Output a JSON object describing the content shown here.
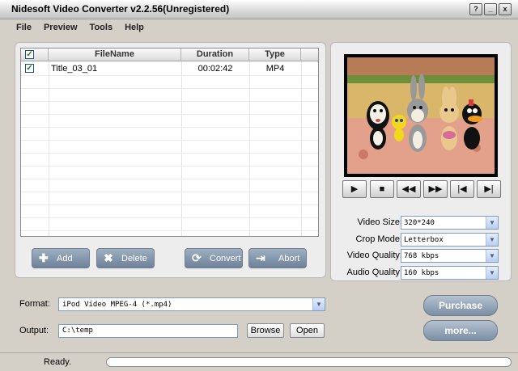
{
  "window": {
    "title": "Nidesoft Video Converter v2.2.56(Unregistered)"
  },
  "window_controls": [
    "?",
    "_",
    "x"
  ],
  "menu": [
    "File",
    "Preview",
    "Tools",
    "Help"
  ],
  "file_list": {
    "columns": [
      "FileName",
      "Duration",
      "Type"
    ],
    "rows": [
      {
        "checked": true,
        "name": "Title_03_01",
        "duration": "00:02:42",
        "type": "MP4"
      }
    ]
  },
  "actions": {
    "add": "Add",
    "delete": "Delete",
    "convert": "Convert",
    "abort": "Abort"
  },
  "player_controls": [
    "play-icon",
    "stop-icon",
    "rewind-icon",
    "fast-forward-icon",
    "skip-start-icon",
    "skip-end-icon"
  ],
  "settings": {
    "video_size": {
      "label": "Video Size:",
      "value": "320*240"
    },
    "crop_mode": {
      "label": "Crop Mode:",
      "value": "Letterbox"
    },
    "video_quality": {
      "label": "Video Quality:",
      "value": "768 kbps"
    },
    "audio_quality": {
      "label": "Audio Quality:",
      "value": "160 kbps"
    }
  },
  "format": {
    "label": "Format:",
    "value": "iPod Video MPEG-4 (*.mp4)"
  },
  "output": {
    "label": "Output:",
    "value": "C:\\temp",
    "browse": "Browse",
    "open": "Open"
  },
  "buttons": {
    "purchase": "Purchase",
    "more": "more..."
  },
  "status": {
    "text": "Ready.",
    "progress": 0
  }
}
